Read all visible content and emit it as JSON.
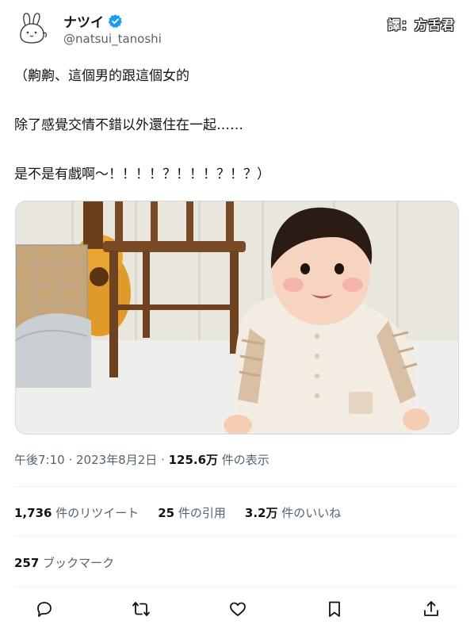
{
  "watermark": "譯：方舌君",
  "author": {
    "display_name": "ナツイ",
    "handle": "@natsui_tanoshi",
    "verified": true,
    "avatar_icon": "bunny-avatar-icon"
  },
  "tweet": {
    "lines": [
      "（齁齁、這個男的跟這個女的",
      "除了感覺交情不錯以外還住在一起……",
      "是不是有戲啊～！！！！？！！！？！？）"
    ],
    "media_alt": "baby-sitting-photo"
  },
  "meta": {
    "time": "午後7:10",
    "sep1": " · ",
    "date": "2023年8月2日",
    "sep2": " · ",
    "views_count": "125.6万",
    "views_label": " 件の表示"
  },
  "stats": {
    "retweets_count": "1,736",
    "retweets_label": " 件のリツイート",
    "quotes_count": "25",
    "quotes_label": " 件の引用",
    "likes_count": "3.2万",
    "likes_label": " 件のいいね"
  },
  "bookmarks": {
    "count": "257",
    "label": " ブックマーク"
  },
  "actions": {
    "reply": "reply-icon",
    "retweet": "retweet-icon",
    "like": "heart-icon",
    "bookmark": "bookmark-icon",
    "share": "share-icon"
  },
  "colors": {
    "text": "#0f1419",
    "secondary": "#536471",
    "verified": "#1d9bf0",
    "divider": "#eff3f4"
  }
}
